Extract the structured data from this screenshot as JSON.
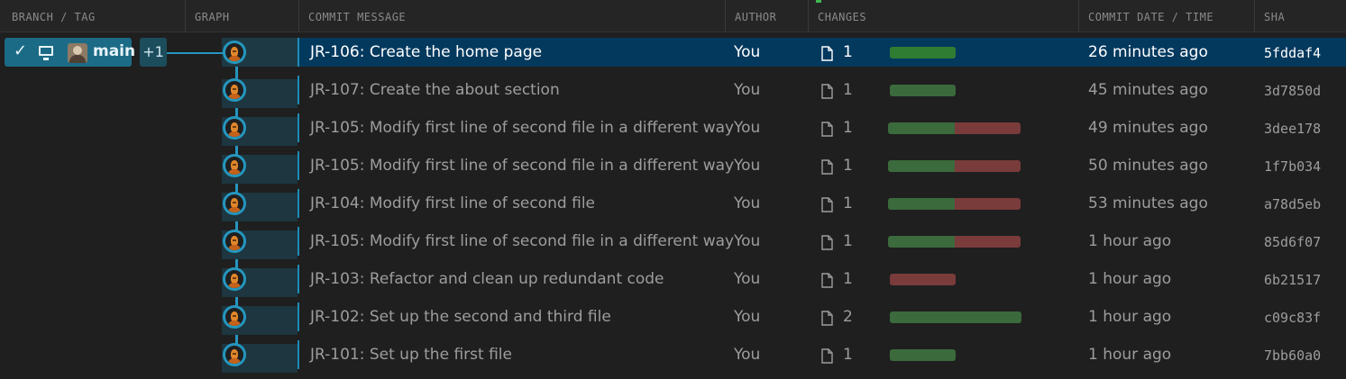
{
  "header": {
    "branch_tag": "BRANCH / TAG",
    "graph": "GRAPH",
    "commit_message": "COMMIT MESSAGE",
    "author": "AUTHOR",
    "changes": "CHANGES",
    "date_time": "COMMIT DATE / TIME",
    "sha": "SHA"
  },
  "branch": {
    "name": "main",
    "extra_count": "+1",
    "icons": [
      "check-icon",
      "computer-icon",
      "avatar"
    ]
  },
  "colors": {
    "added": "#2f7d32",
    "added_dim": "#3b6a3c",
    "deleted": "#8b3a3a",
    "deleted_dim": "#7a3b3b",
    "accent": "#2596be",
    "selected_row": "#04395e"
  },
  "commits": [
    {
      "message": "JR-106: Create the home page",
      "author": "You",
      "files": "1",
      "added": 1,
      "deleted": 0,
      "date": "26 minutes ago",
      "sha": "5fddaf4",
      "selected": true
    },
    {
      "message": "JR-107: Create the about section",
      "author": "You",
      "files": "1",
      "added": 1,
      "deleted": 0,
      "date": "45 minutes ago",
      "sha": "3d7850d"
    },
    {
      "message": "JR-105: Modify first line of second file in a different way",
      "author": "You",
      "files": "1",
      "added": 1,
      "deleted": 1,
      "date": "49 minutes ago",
      "sha": "3dee178"
    },
    {
      "message": "JR-105: Modify first line of second file in a different way",
      "author": "You",
      "files": "1",
      "added": 1,
      "deleted": 1,
      "date": "50 minutes ago",
      "sha": "1f7b034"
    },
    {
      "message": "JR-104: Modify first line of second file",
      "author": "You",
      "files": "1",
      "added": 1,
      "deleted": 1,
      "date": "53 minutes ago",
      "sha": "a78d5eb"
    },
    {
      "message": "JR-105: Modify first line of second file in a different way",
      "author": "You",
      "files": "1",
      "added": 1,
      "deleted": 1,
      "date": "1 hour ago",
      "sha": "85d6f07"
    },
    {
      "message": "JR-103: Refactor and clean up redundant code",
      "author": "You",
      "files": "1",
      "added": 0,
      "deleted": 1,
      "date": "1 hour ago",
      "sha": "6b21517"
    },
    {
      "message": "JR-102: Set up the second and third file",
      "author": "You",
      "files": "2",
      "added": 2,
      "deleted": 0,
      "date": "1 hour ago",
      "sha": "c09c83f"
    },
    {
      "message": "JR-101: Set up the first file",
      "author": "You",
      "files": "1",
      "added": 1,
      "deleted": 0,
      "date": "1 hour ago",
      "sha": "7bb60a0"
    }
  ]
}
